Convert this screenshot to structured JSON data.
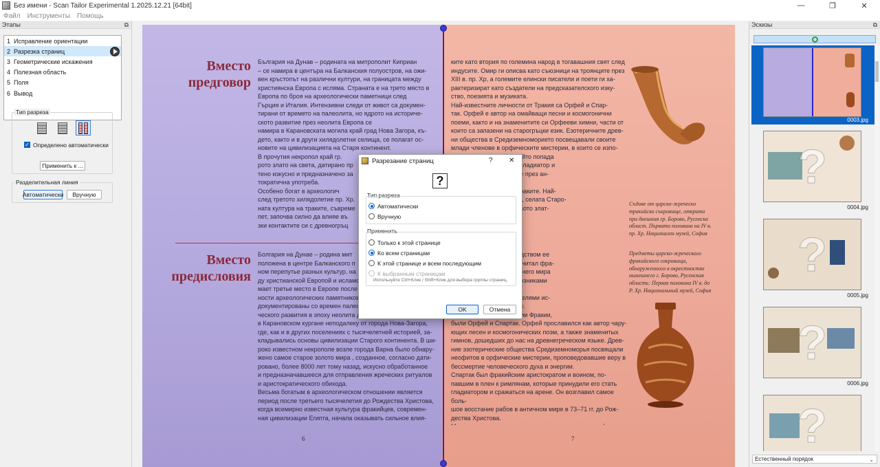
{
  "window": {
    "title": "Без имени - Scan Tailor Experimental 1.2025.12.21 [64bit]",
    "minimize": "—",
    "maximize": "❐",
    "close": "✕"
  },
  "menu": [
    "Файл",
    "Инструменты",
    "Помощь"
  ],
  "left_panel": {
    "header": "Этапы",
    "stages": [
      {
        "num": "1",
        "label": "Исправление ориентации"
      },
      {
        "num": "2",
        "label": "Разрезка страниц"
      },
      {
        "num": "3",
        "label": "Геометрические искажения"
      },
      {
        "num": "4",
        "label": "Полезная область"
      },
      {
        "num": "5",
        "label": "Поля"
      },
      {
        "num": "6",
        "label": "Вывод"
      }
    ],
    "cut_type_label": "Тип разреза",
    "auto_detected_label": "Определено автоматически",
    "apply_button": "Применить к ...",
    "split_line_label": "Разделительная линия",
    "auto_button": "Автоматически",
    "manual_button": "Вручную"
  },
  "scan": {
    "left_heading_1": "Вместо\nпредговор",
    "left_heading_2": "Вместо\nпредисловия",
    "left_text_1": "България на Дунав – родината на митрополит Киприан\n– се намира в центъра на Балканския полуостров, на ожи-\nвен кръстопът на различни култури, на границата между\nхристиянска Европа с ислямa. Страната е на трето място в\nЕвропа по броя на археологически паметници след\nГърция и Италия. Интензивни следи от живот са докумен-\nтирани от времето на палеолита, но ядрото на историче-\nското развитие през неолита Европа се\nнамира в Карановската могила край град Нова Загора, къ-\nдето, както и в други хилядолетни селища, се полагат ос-\nновите на цивилизацията на Старя континент.\n      В прочутия некропол край гр.\nрото злато на света, датирано пр\nтено изкусно и предназначено за\nтократична употреба.\n      Особено богат в археологич\nслед третото хилядолетие пр. Хр.\nната култура на траките, съвремe\nпет, започва силно да влияе въ\nзки контактите си с древногръц",
    "left_text_2": "Болгария на Дунае – родина мит\nположена в центре Балканского п\nном перепутье разных культур, на гр\nду христианской Европой и исламо\nмает третье место в Европе после Г\nности археологических памятников.\nдокументированы со времен палео\nческого развития в эпоху неолита д\nв Карановском кургане неподалеку от города Нова-Загора,\nгде, как и в других поселениях с тысячелетней историей, за-\nкладывались основы цивилизации Старого континента. В ши-\nроко известном некрополе возле города Варна было обнару-\nжено самое старое золото мира , созданное, согласно дати-\nровано, более 8000 лет тому назад, искусно обработанное\nи предназначавшееся для отправления жреческих ритуалов\nи аристократического обихода.\n      Весьма богатым в археологическом отношении является\nпериод после третьего тысячелетия до Рождества Христова,\nкогда всемирно известная культура фракийцев, современ-\nная цивилизации Египта, начала оказывать сильное влия-",
    "right_text_1": "ките като втория по големина народ в тогавашния свят след\nиндусите. Омир ги описва като съюзници на троянците през\nXIII в. пр. Хр, а големите елински писатели и поети ги ха-\nрактеризират като създатели на предсказателского изку-\nство, поезията и музиката.\n      Най-известните личности от Тракия са Орфей и Спар-\nтак. Орфей е автор на омайващи песни и космогонични\nпоеми, както и на знаменитите си Орфееви химни, части от\nкоито са запазени на старогръцки език. Езотеричните древ-\nни общества в Средиземноморието посвещавали своите\nмлади членове в орфическите мистерии, в които се изпо-\n                               аристократ и офицер, който попада\n                               ставен е да се бие като гладиатор и\n                               мото въстание на робите през ан-\n                               р. Хр.\n                               итниците, останали от траките. Най-\n                               трий край град Казанлък, селата Старо-\n                               ещари, както и множеството злат-\n                               на сьокровища.",
    "right_text_2": "                               кую цивилизацию посредством ее\n                               кой культурой. Геродот считал фра-\n                               венным народом тогдашнего мира\n                               мечал, что они были союзниками\n                               в Хр., а выдающиеся\n                               зтов называли их создателями ис-\n                               кусства, поэзии и музыки.\n                               личностями – уроженцами Фракии,\nбыли Орфей и Спартак. Орфей прославился как автор чару-\nющих песен и космогонических поэм, а также знаменитых\nгимнов, дошедших до нас на древнегреческом языке. Древ-\nние эзотерические общества Средиземноморья посвящали\nнеофитов в орфические мистерии, проповедовавшие веру в\nбессмертие человеческого духа и энергии.\n      Спартак был фракийским аристократом и воином, по-\nпавшим в плен к римлянам, которые принудили его стать\nгладиатором и сражаться на арене. Он возглавил самое боль-\nшое восстание рабов в античном мире в 73–71 гг. до Рож-\nдества Христова.\n      Многочисленны памятники, оставленные древними фра-",
    "caption_1": "Съдове от царско-жреческо\nтракийско съкровище, открито\nпри днешния гр. Борово, Русенска\nобласт. Първата половина на IV в.\nпр. Хр. Национален музей, София",
    "caption_2": "Предметы царско-жреческого\nфракийского сокровища,\nобнаруженного в окрестностях\nнынешнего г. Борово, Русенская\nобласть: Первая половина IV в. до\nР. Хр. Национальный музей, София",
    "page_left": "6",
    "page_right": "7"
  },
  "dialog": {
    "title": "Разрезание страниц",
    "help": "?",
    "close": "✕",
    "question_icon": "?",
    "cut_type_label": "Тип разреза",
    "options_cut": [
      "Автоматически",
      "Вручную"
    ],
    "apply_label": "Применить",
    "options_apply": [
      "Только к этой странице",
      "Ко всем страницам",
      "К этой странице и всем последующим",
      "К выбранным страницам"
    ],
    "hint": "Используйте Ctrl+Клик / Shift+Клик для выбора группы страниц.",
    "ok": "OK",
    "cancel": "Отмена"
  },
  "right_panel": {
    "header": "Эскизы",
    "thumbnails": [
      {
        "label": "0003.jpg",
        "selected": true
      },
      {
        "label": "0004.jpg",
        "selected": false
      },
      {
        "label": "0005.jpg",
        "selected": false
      },
      {
        "label": "0006.jpg",
        "selected": false
      },
      {
        "label": "",
        "selected": false
      }
    ],
    "sort_order": "Естественный порядок",
    "thumb_placeholder": "?"
  }
}
